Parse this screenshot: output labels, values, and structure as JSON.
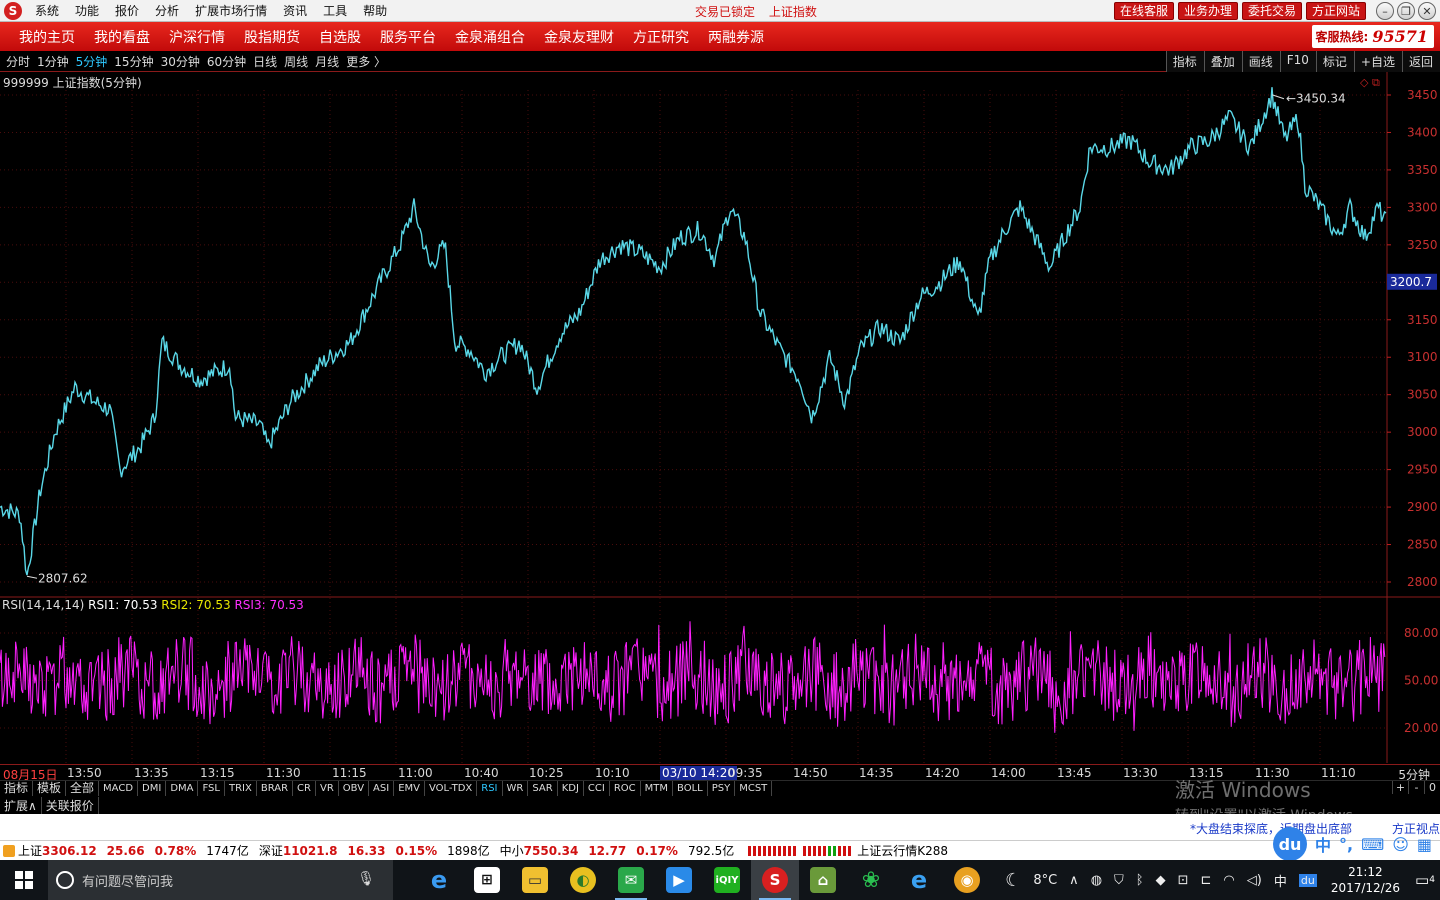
{
  "menu": [
    "系统",
    "功能",
    "报价",
    "分析",
    "扩展市场行情",
    "资讯",
    "工具",
    "帮助"
  ],
  "title_status": [
    "交易已锁定",
    "上证指数"
  ],
  "title_buttons": [
    "在线客服",
    "业务办理",
    "委托交易",
    "方正网站"
  ],
  "nav": [
    "我的主页",
    "我的看盘",
    "沪深行情",
    "股指期货",
    "自选股",
    "服务平台",
    "金泉涌组合",
    "金泉友理财",
    "方正研究",
    "两融券源"
  ],
  "hotline": {
    "label": "客服热线:",
    "number": "95571"
  },
  "periods": [
    "分时",
    "1分钟",
    "5分钟",
    "15分钟",
    "30分钟",
    "60分钟",
    "日线",
    "周线",
    "月线",
    "更多 〉"
  ],
  "active_period": "5分钟",
  "toolbar": [
    "指标",
    "叠加",
    "画线",
    "F10",
    "标记",
    "+自选",
    "返回"
  ],
  "chart": {
    "title": "999999 上证指数(5分钟)",
    "price_axis": [
      "3450",
      "3400",
      "3350",
      "3300",
      "3250",
      "3200",
      "3150",
      "3100",
      "3050",
      "3000",
      "2950",
      "2900",
      "2850",
      "2800"
    ],
    "current_price_tag": "3200.7",
    "high_label": "3450.34",
    "low_label": "2807.62",
    "price_color": "#5ad8e8",
    "rsi_title": {
      "name": "RSI(14,14,14)",
      "r1": "RSI1: 70.53",
      "r2": "RSI2: 70.53",
      "r3": "RSI3: 70.53"
    },
    "rsi_axis": [
      "80.00",
      "50.00",
      "20.00"
    ],
    "rsi_color": "#ff20ff"
  },
  "time_axis": {
    "first": "08月15日",
    "labels": [
      "13:50",
      "13:35",
      "13:15",
      "11:30",
      "11:15",
      "11:00",
      "10:40",
      "10:25",
      "10:10",
      "09:35",
      "14:50",
      "14:35",
      "14:20",
      "14:00",
      "13:45",
      "13:30",
      "13:15",
      "11:30",
      "11:10"
    ],
    "cursor": "03/10 14:20",
    "freq": "5分钟"
  },
  "indicator_tabs": [
    "指标",
    "模板",
    "全部",
    "MACD",
    "DMI",
    "DMA",
    "FSL",
    "TRIX",
    "BRAR",
    "CR",
    "VR",
    "OBV",
    "ASI",
    "EMV",
    "VOL-TDX",
    "RSI",
    "WR",
    "SAR",
    "KDJ",
    "CCI",
    "ROC",
    "MTM",
    "BOLL",
    "PSY",
    "MCST"
  ],
  "active_indicator": "RSI",
  "ind_right": [
    "+",
    "-",
    "0"
  ],
  "ext_tabs": [
    "扩展∧",
    "关联报价"
  ],
  "watermark": {
    "line1": "激活 Windows",
    "line2": "转到\"设置\"以激活 Windows。"
  },
  "news": {
    "text": "*大盘结束探底，近期盘出底部",
    "more": "方正视点"
  },
  "status": {
    "sh_name": "上证",
    "sh_price": "3306.12",
    "sh_chg": "25.66",
    "sh_pct": "0.78%",
    "sh_vol": "1747亿",
    "sz_name": "深证",
    "sz_price": "11021.8",
    "sz_chg": "16.33",
    "sz_pct": "0.15%",
    "sz_vol": "1898亿",
    "zx_name": "中小",
    "zx_price": "7550.34",
    "zx_chg": "12.77",
    "zx_pct": "0.17%",
    "zx_vol": "792.5亿",
    "cloud": "上证云行情K288"
  },
  "taskbar": {
    "search_placeholder": "有问题尽管问我",
    "weather": "8°C",
    "ime_lang": "中",
    "time": "21:12",
    "date": "2017/12/26",
    "notif_count": "4"
  }
}
